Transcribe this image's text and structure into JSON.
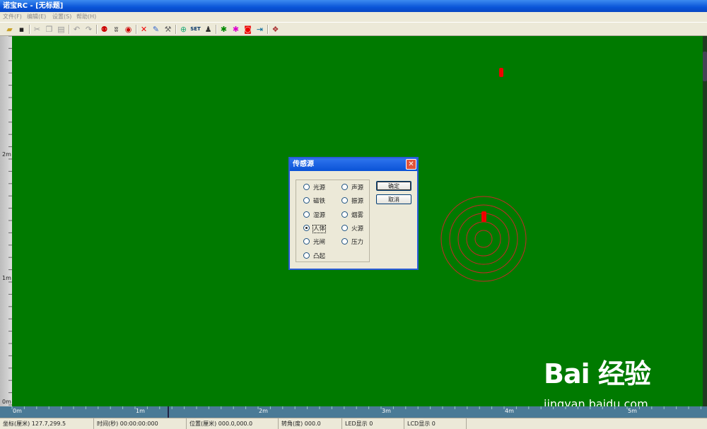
{
  "window": {
    "title": "诺宝RC - [无标题]"
  },
  "menu": [
    {
      "label": "文件(F)"
    },
    {
      "label": "编辑(E)"
    },
    {
      "label": "设置(S)"
    },
    {
      "label": "帮助(H)"
    }
  ],
  "toolbar": {
    "icons": [
      "open-icon",
      "save-icon",
      "cut-icon",
      "copy-icon",
      "paste-icon",
      "undo-icon",
      "redo-icon",
      "robot-icon",
      "sensor-icon",
      "eye-icon",
      "delete-icon",
      "brush-icon",
      "tools-icon",
      "target-icon",
      "set-icon",
      "robot2-icon",
      "run-icon",
      "run2-icon",
      "stop-icon",
      "exit-icon",
      "book-icon"
    ],
    "set_label": "SET"
  },
  "ruler": {
    "left_labels": [
      "2m",
      "1m",
      "0m"
    ],
    "bottom_labels": [
      "0m",
      "1m",
      "2m",
      "3m",
      "4m",
      "5m"
    ]
  },
  "status": {
    "coord": "坐标(厘米) 127.7,299.5",
    "time": "时间(秒) 00:00:00:000",
    "position": "位置(厘米) 000.0,000.0",
    "angle": "转角(度) 000.0",
    "led": "LED显示  0",
    "lcd": "LCD显示  0"
  },
  "dialog": {
    "title": "传感源",
    "close": "✕",
    "options": [
      {
        "label": "光源",
        "selected": false
      },
      {
        "label": "声源",
        "selected": false
      },
      {
        "label": "磁铁",
        "selected": false
      },
      {
        "label": "振源",
        "selected": false
      },
      {
        "label": "湿源",
        "selected": false
      },
      {
        "label": "烟雾",
        "selected": false
      },
      {
        "label": "人体",
        "selected": true
      },
      {
        "label": "火源",
        "selected": false
      },
      {
        "label": "光闸",
        "selected": false
      },
      {
        "label": "压力",
        "selected": false
      },
      {
        "label": "凸起",
        "selected": false
      }
    ],
    "ok": "确定",
    "cancel": "取消"
  },
  "watermark": {
    "brand": "Bai  经验",
    "url": "jingyan.baidu.com"
  },
  "colors": {
    "field": "#007a00",
    "accent": "#0a55d8",
    "source_ring": "#c62828"
  }
}
